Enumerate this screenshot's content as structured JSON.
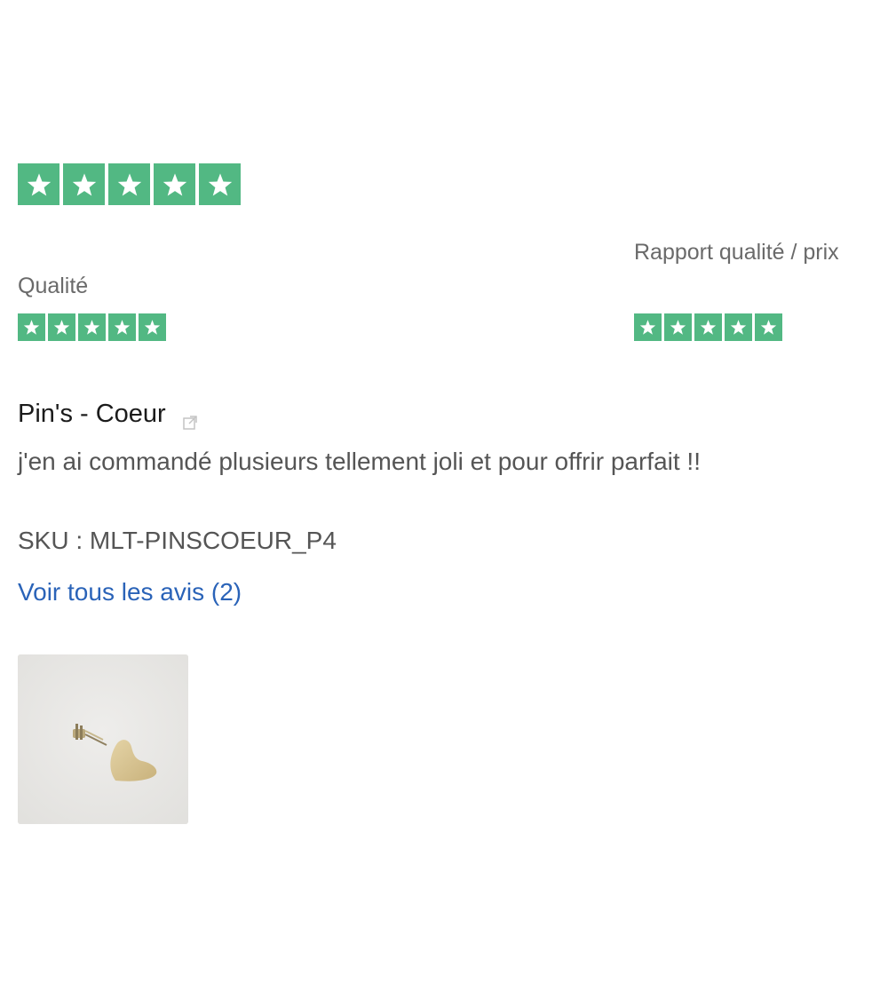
{
  "overall_rating": {
    "stars": 5,
    "max": 5,
    "color": "#52b883"
  },
  "sub_ratings": [
    {
      "label": "Qualité",
      "stars": 5,
      "max": 5
    },
    {
      "label": "Rapport qualité / prix",
      "stars": 5,
      "max": 5
    }
  ],
  "product": {
    "title": "Pin's - Coeur",
    "external_link_icon": "external-link-icon"
  },
  "review": {
    "text": "j'en ai commandé plusieurs tellement joli et pour offrir parfait !!"
  },
  "sku": "SKU : MLT-PINSCOEUR_P4",
  "see_all_link": "Voir tous les avis (2)",
  "colors": {
    "star_green": "#52b883",
    "link_blue": "#2a63b8",
    "text_gray": "#555555"
  }
}
